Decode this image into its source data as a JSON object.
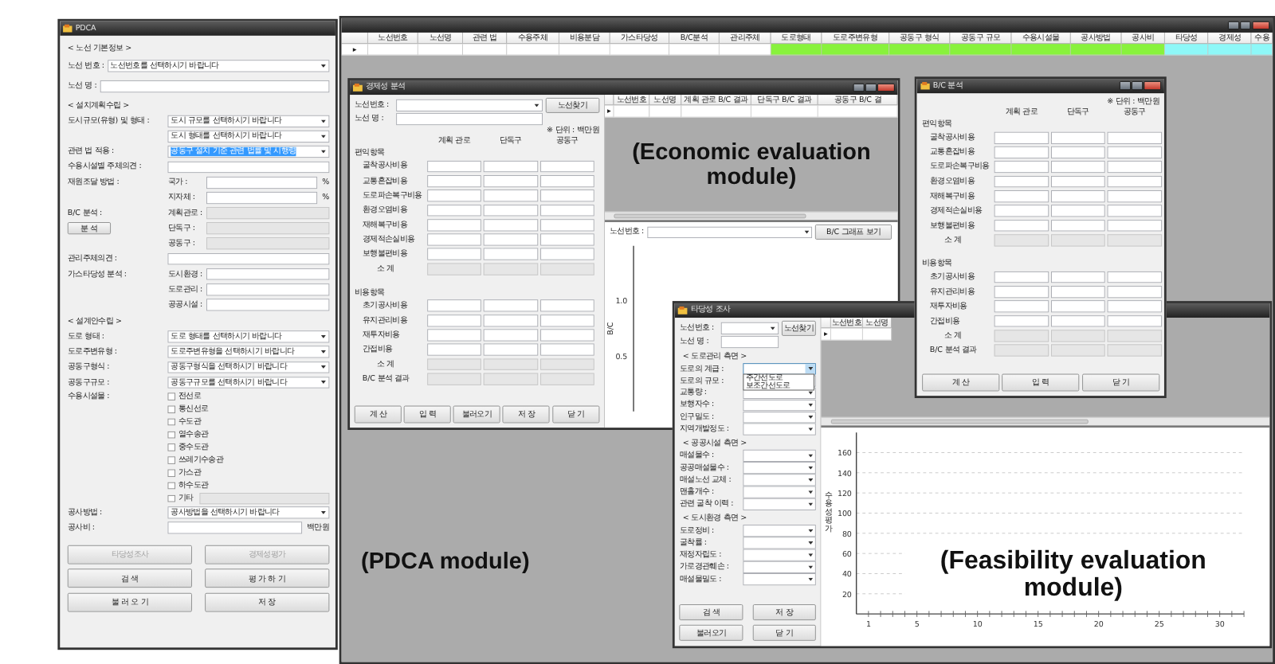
{
  "pdca_window": {
    "title": "PDCA",
    "rows": [
      {
        "kind": "heading",
        "text": "< 노선 기본정보 >"
      },
      {
        "kind": "wide_select",
        "label": "노선 번호 :",
        "value": "노선번호를 선택하시기 바랍니다",
        "highlighted": false
      },
      {
        "kind": "wide_input",
        "label": "노선 명 :",
        "readonly": false
      },
      {
        "kind": "heading",
        "text": "< 설치계획수립 >"
      },
      {
        "kind": "select",
        "label": "도시규모(유형) 및 형태 :",
        "value": "도시 규모를 선택하시기 바랍니다",
        "highlighted": false
      },
      {
        "kind": "select",
        "value": "도시 형태를 선택하시기 바랍니다",
        "highlighted": false
      },
      {
        "kind": "select",
        "label": "관련 법 적용 :",
        "value": "공동구 설치 기준 관련 법률 및 시행령",
        "highlighted": true
      },
      {
        "kind": "input",
        "label": "수용시설별 주체의견 :",
        "readonly": false
      },
      {
        "kind": "sub",
        "label": "재원조달 방법 :",
        "sublabel": "국가 :",
        "unit": "%",
        "readonly": false
      },
      {
        "kind": "sub",
        "sublabel": "지자체 :",
        "unit": "%",
        "readonly": false
      },
      {
        "kind": "sub",
        "label": "B/C 분석 :",
        "sublabel": "계획관로 :",
        "readonly": true
      },
      {
        "kind": "sub",
        "button": "분 석",
        "sublabel": "단독구 :",
        "readonly": true
      },
      {
        "kind": "sub",
        "sublabel": "공동구 :",
        "readonly": true
      },
      {
        "kind": "input",
        "label": "관리주체의견 :",
        "readonly": false
      },
      {
        "kind": "sub",
        "label": "가스타당성 분석 :",
        "sublabel": "도시환경 :",
        "readonly": false
      },
      {
        "kind": "sub",
        "sublabel": "도로관리 :",
        "readonly": false
      },
      {
        "kind": "sub",
        "sublabel": "공공시설 :",
        "readonly": false
      },
      {
        "kind": "heading",
        "text": "< 설계안수립 >"
      },
      {
        "kind": "select",
        "label": "도로 형태 :",
        "value": "도로 형태를 선택하시기 바랍니다",
        "highlighted": false
      },
      {
        "kind": "select",
        "label": "도로주변유형 :",
        "value": "도로주변유형을 선택하시기 바랍니다",
        "highlighted": false
      },
      {
        "kind": "select",
        "label": "공동구형식 :",
        "value": "공동구형식을 선택하시기 바랍니다",
        "highlighted": false
      },
      {
        "kind": "select",
        "label": "공동구규모 :",
        "value": "공동구규모를 선택하시기 바랍니다",
        "highlighted": false
      },
      {
        "kind": "checks",
        "label": "수용시설물 :",
        "items": [
          {
            "label": "전선로",
            "checked": false
          },
          {
            "label": "통신선로",
            "checked": false
          },
          {
            "label": "수도관",
            "checked": false
          },
          {
            "label": "열수송관",
            "checked": false
          },
          {
            "label": "중수도관",
            "checked": false
          },
          {
            "label": "쓰레기수송관",
            "checked": false
          },
          {
            "label": "가스관",
            "checked": false
          },
          {
            "label": "하수도관",
            "checked": false
          },
          {
            "label": "기타",
            "checked": false,
            "with_input": true
          }
        ]
      },
      {
        "kind": "select",
        "label": "공사방법 :",
        "value": "공사방법을 선택하시기 바랍니다",
        "highlighted": false
      },
      {
        "kind": "input",
        "label": "공사비 :",
        "unit": "백만원",
        "readonly": false
      }
    ],
    "buttons": [
      {
        "label": "타당성조사",
        "disabled": true
      },
      {
        "label": "경제성평가",
        "disabled": true
      },
      {
        "label": "검 색",
        "disabled": false
      },
      {
        "label": "평 가 하 기",
        "disabled": false
      },
      {
        "label": "불 러 오 기",
        "disabled": false
      },
      {
        "label": "저 장",
        "disabled": false
      }
    ]
  },
  "main_window": {
    "row_marker": "▸",
    "columns": [
      {
        "label": "노선번호"
      },
      {
        "label": "노선명"
      },
      {
        "label": "관련 법"
      },
      {
        "label": "수용주체"
      },
      {
        "label": "비용분담"
      },
      {
        "label": "가스타당성"
      },
      {
        "label": "B/C분석"
      },
      {
        "label": "관리주체"
      },
      {
        "label": "도로형태",
        "color": "#88f23c"
      },
      {
        "label": "도로주변유형",
        "color": "#88f23c"
      },
      {
        "label": "공동구 형식",
        "color": "#88f23c"
      },
      {
        "label": "공동구 규모",
        "color": "#88f23c"
      },
      {
        "label": "수용시설물",
        "color": "#88f23c"
      },
      {
        "label": "공사방법",
        "color": "#88f23c"
      },
      {
        "label": "공사비",
        "color": "#88f23c"
      },
      {
        "label": "타당성",
        "color": "#8ef8f8"
      },
      {
        "label": "경제성",
        "color": "#8ef8f8"
      },
      {
        "label": "수용",
        "color": "#8ef8f8"
      }
    ],
    "caption": "(PDCA module)"
  },
  "economic_window": {
    "title": "경제성 분석",
    "route_no_label": "노선번호 :",
    "route_name_label": "노선 명 :",
    "find_button": "노선찾기",
    "form": {
      "unit_note": "※ 단위 : 백만원",
      "columns": [
        "계획 관로",
        "단독구",
        "공동구"
      ],
      "benefit_heading": "편익항목",
      "benefit_rows": [
        "굴착공사비용",
        "교통혼잡비용",
        "도로파손복구비용",
        "환경오염비용",
        "재해복구비용",
        "경제적손실비용",
        "보행불편비용"
      ],
      "benefit_subtotal": "소 계",
      "cost_heading": "비용항목",
      "cost_rows": [
        "초기공사비용",
        "유지관리비용",
        "재투자비용",
        "간접비용"
      ],
      "cost_subtotal": "소 계",
      "result_label": "B/C 분석 결과"
    },
    "buttons": [
      "계 산",
      "입 력",
      "불러오기",
      "저 장",
      "닫 기"
    ],
    "row_marker": "▸",
    "grid_columns": [
      "노선번호",
      "노선명",
      "계획 관로 B/C 결과",
      "단독구 B/C 결과",
      "공동구 B/C 결"
    ],
    "caption": "(Economic evaluation module)",
    "graph_route_label": "노선번호 :",
    "graph_button": "B/C 그래프 보기",
    "graph": {
      "axis_label": "B/C",
      "tick_labels": [
        "1.0",
        "0.5"
      ]
    }
  },
  "feasibility_window": {
    "title": "타당성 조사",
    "route_no_label": "노선번호 :",
    "route_name_label": "노선 명 :",
    "find_button": "노선찾기",
    "groups": [
      {
        "heading": "< 도로관리 측면 >",
        "fields": [
          {
            "label": "도로의 계급 :",
            "open": true,
            "options": [
              "주간선도로",
              "보조간선도로"
            ]
          },
          {
            "label": "도로의 규모 :",
            "open": false
          },
          {
            "label": "교통량 :",
            "open": false
          },
          {
            "label": "보행자수 :",
            "open": false
          },
          {
            "label": "인구밀도 :",
            "open": false
          },
          {
            "label": "지역개발정도 :",
            "open": false
          }
        ]
      },
      {
        "heading": "< 공공시설 측면 >",
        "fields": [
          {
            "label": "매설물수 :",
            "open": false
          },
          {
            "label": "공공매설물수 :",
            "open": false
          },
          {
            "label": "매설노선 교체 :",
            "open": false
          },
          {
            "label": "맨홀개수 :",
            "open": false
          },
          {
            "label": "관련 굴착 이력 :",
            "open": false
          }
        ]
      },
      {
        "heading": "< 도시환경 측면 >",
        "fields": [
          {
            "label": "도로정비 :",
            "open": false
          },
          {
            "label": "굴착률 :",
            "open": false
          },
          {
            "label": "재정자립도 :",
            "open": false
          },
          {
            "label": "가로경관훼손 :",
            "open": false
          },
          {
            "label": "매설물밀도 :",
            "open": false
          }
        ]
      }
    ],
    "buttons": [
      "검 색",
      "저 장",
      "불러오기",
      "닫 기"
    ],
    "row_marker": "▸",
    "grid_columns": [
      "노선번호",
      "노선명"
    ],
    "caption": "(Feasibility evaluation module)",
    "chart_data": {
      "type": "line",
      "grid": true,
      "ylabel": "수용성평가",
      "xlim": [
        0,
        32
      ],
      "ylim": [
        0,
        180
      ],
      "xticks": [
        1,
        5,
        10,
        15,
        20,
        25,
        30
      ],
      "yticks": [
        20,
        40,
        60,
        80,
        100,
        120,
        140,
        160
      ]
    }
  },
  "bc_window": {
    "title": "B/C 분석",
    "form": {
      "unit_note": "※ 단위 : 백만원",
      "columns": [
        "계획 관로",
        "단독구",
        "공동구"
      ],
      "benefit_heading": "편익항목",
      "benefit_rows": [
        "굴착공사비용",
        "교통혼잡비용",
        "도로파손복구비용",
        "환경오염비용",
        "재해복구비용",
        "경제적손실비용",
        "보행불편비용"
      ],
      "benefit_subtotal": "소 계",
      "cost_heading": "비용항목",
      "cost_rows": [
        "초기공사비용",
        "유지관리비용",
        "재투자비용",
        "간접비용"
      ],
      "cost_subtotal": "소 계",
      "result_label": "B/C 분석 결과"
    },
    "buttons": [
      "계 산",
      "입 력",
      "닫 기"
    ]
  }
}
